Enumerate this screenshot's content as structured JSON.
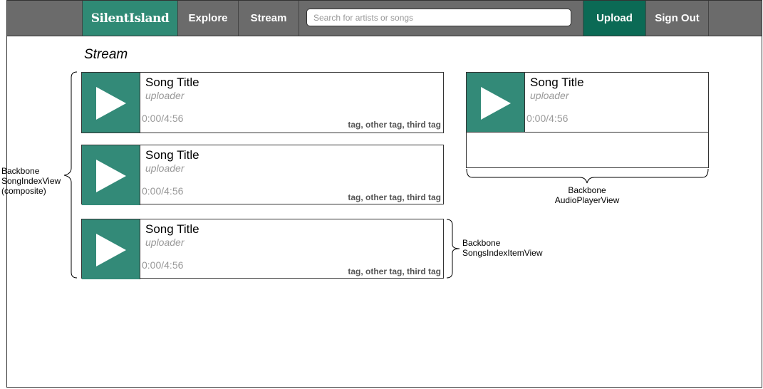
{
  "nav": {
    "brand": "SilentIsland",
    "explore": "Explore",
    "stream": "Stream",
    "search_placeholder": "Search for artists or songs",
    "upload": "Upload",
    "signout": "Sign Out"
  },
  "page": {
    "title": "Stream"
  },
  "songs": [
    {
      "title": "Song Title",
      "uploader": "uploader",
      "time": "0:00/4:56",
      "tags": "tag, other tag, third tag"
    },
    {
      "title": "Song Title",
      "uploader": "uploader",
      "time": "0:00/4:56",
      "tags": "tag, other tag, third tag"
    },
    {
      "title": "Song Title",
      "uploader": "uploader",
      "time": "0:00/4:56",
      "tags": "tag, other tag, third tag"
    }
  ],
  "player": {
    "title": "Song Title",
    "uploader": "uploader",
    "time": "0:00/4:56"
  },
  "annotations": {
    "song_index_view": [
      "Backbone",
      "SongIndexView",
      "(composite)"
    ],
    "audio_player_view": [
      "Backbone",
      "AudioPlayerView"
    ],
    "songs_index_item_view": [
      "Backbone",
      "SongsIndexItemView"
    ]
  },
  "colors": {
    "brand": "#2f8a75",
    "upload": "#0b6a55",
    "nav": "#6b6b6b",
    "thumb": "#338a78"
  },
  "icons": {
    "play": "play-icon"
  }
}
